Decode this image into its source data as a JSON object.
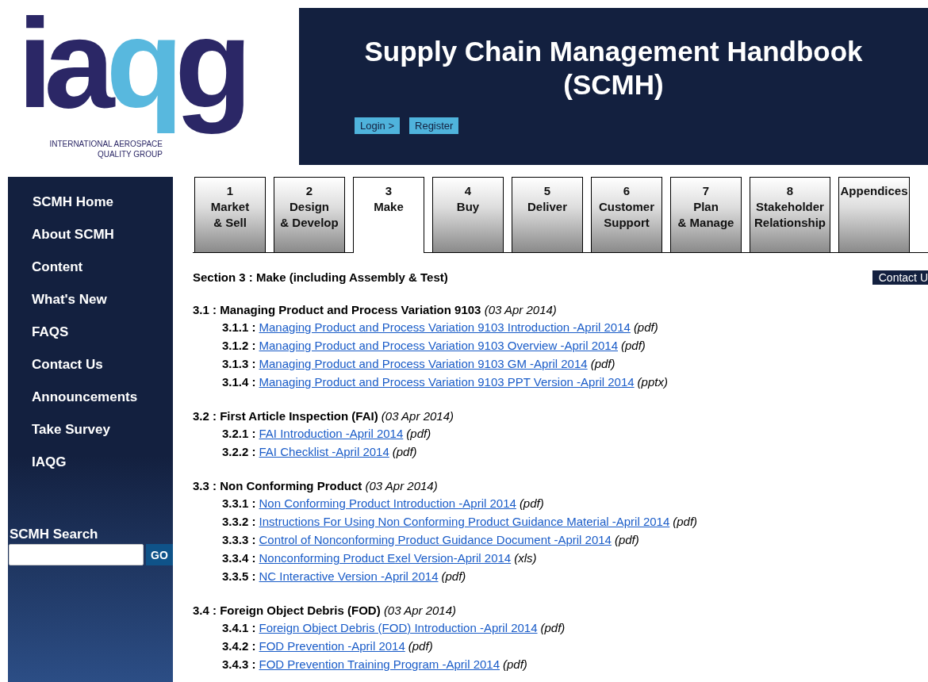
{
  "logo": {
    "letters": "iaqg",
    "tagline": [
      "INTERNATIONAL AEROSPACE",
      "QUALITY GROUP"
    ]
  },
  "banner": {
    "title": [
      "Supply Chain Management Handbook",
      "(SCMH)"
    ],
    "buttons": [
      "Login >",
      "Register"
    ]
  },
  "sidebar": {
    "items": [
      "SCMH Home",
      "About SCMH",
      "Content",
      "What's New",
      "FAQS",
      "Contact Us",
      "Announcements",
      "Take Survey",
      "IAQG"
    ],
    "search": {
      "label": "SCMH Search",
      "button": "GO"
    }
  },
  "tabs": [
    {
      "number": "1",
      "label": [
        "Market",
        "& Sell"
      ],
      "selected": false
    },
    {
      "number": "2",
      "label": [
        "Design",
        "& Develop"
      ],
      "selected": false
    },
    {
      "number": "3",
      "label": [
        "Make"
      ],
      "selected": true
    },
    {
      "number": "4",
      "label": [
        "Buy"
      ],
      "selected": false
    },
    {
      "number": "5",
      "label": [
        "Deliver"
      ],
      "selected": false
    },
    {
      "number": "6",
      "label": [
        "Customer",
        "Support"
      ],
      "selected": false
    },
    {
      "number": "7",
      "label": [
        "Plan",
        "& Manage"
      ],
      "selected": false
    },
    {
      "number": "8",
      "label": [
        "Stakeholder",
        "Relationship"
      ],
      "selected": false
    },
    {
      "label": [
        "Appendices"
      ],
      "selected": false
    }
  ],
  "section_title": "Section 3 : Make (including Assembly & Test)",
  "contact_button": "Contact U",
  "sections": [
    {
      "number": "3.1 :",
      "title": "Managing Product and Process Variation 9103",
      "date": "(03 Apr 2014)",
      "items": [
        {
          "number": "3.1.1 :",
          "link": "Managing Product and Process Variation 9103 Introduction -April 2014",
          "type": "(pdf)"
        },
        {
          "number": "3.1.2 :",
          "link": "Managing Product and Process Variation 9103 Overview -April 2014",
          "type": "(pdf)"
        },
        {
          "number": "3.1.3 :",
          "link": "Managing Product and Process Variation 9103 GM -April 2014",
          "type": "(pdf)"
        },
        {
          "number": "3.1.4 :",
          "link": "Managing Product and Process Variation 9103 PPT Version -April 2014",
          "type": "(pptx)"
        }
      ]
    },
    {
      "number": "3.2 :",
      "title": "First Article Inspection (FAI)",
      "date": "(03 Apr 2014)",
      "items": [
        {
          "number": "3.2.1 :",
          "link": "FAI Introduction -April 2014",
          "type": "(pdf)"
        },
        {
          "number": "3.2.2 :",
          "link": "FAI Checklist -April 2014",
          "type": "(pdf)"
        }
      ]
    },
    {
      "number": "3.3 :",
      "title": "Non Conforming Product",
      "date": "(03 Apr 2014)",
      "items": [
        {
          "number": "3.3.1 :",
          "link": "Non Conforming Product Introduction -April 2014",
          "type": "(pdf)"
        },
        {
          "number": "3.3.2 :",
          "link": "Instructions For Using Non Conforming Product Guidance Material -April 2014",
          "type": "(pdf)"
        },
        {
          "number": "3.3.3 :",
          "link": "Control of Nonconforming Product Guidance Document -April 2014",
          "type": "(pdf)"
        },
        {
          "number": "3.3.4 :",
          "link": "Nonconforming Product Exel Version-April 2014",
          "type": "(xls)"
        },
        {
          "number": "3.3.5 :",
          "link": "NC Interactive Version -April 2014",
          "type": "(pdf)"
        }
      ]
    },
    {
      "number": "3.4 :",
      "title": "Foreign Object Debris (FOD)",
      "date": "(03 Apr 2014)",
      "items": [
        {
          "number": "3.4.1 :",
          "link": "Foreign Object Debris (FOD) Introduction -April 2014",
          "type": "(pdf)"
        },
        {
          "number": "3.4.2 :",
          "link": "FOD Prevention -April 2014",
          "type": "(pdf)"
        },
        {
          "number": "3.4.3 :",
          "link": "FOD Prevention Training Program -April 2014",
          "type": "(pdf)"
        }
      ]
    }
  ]
}
